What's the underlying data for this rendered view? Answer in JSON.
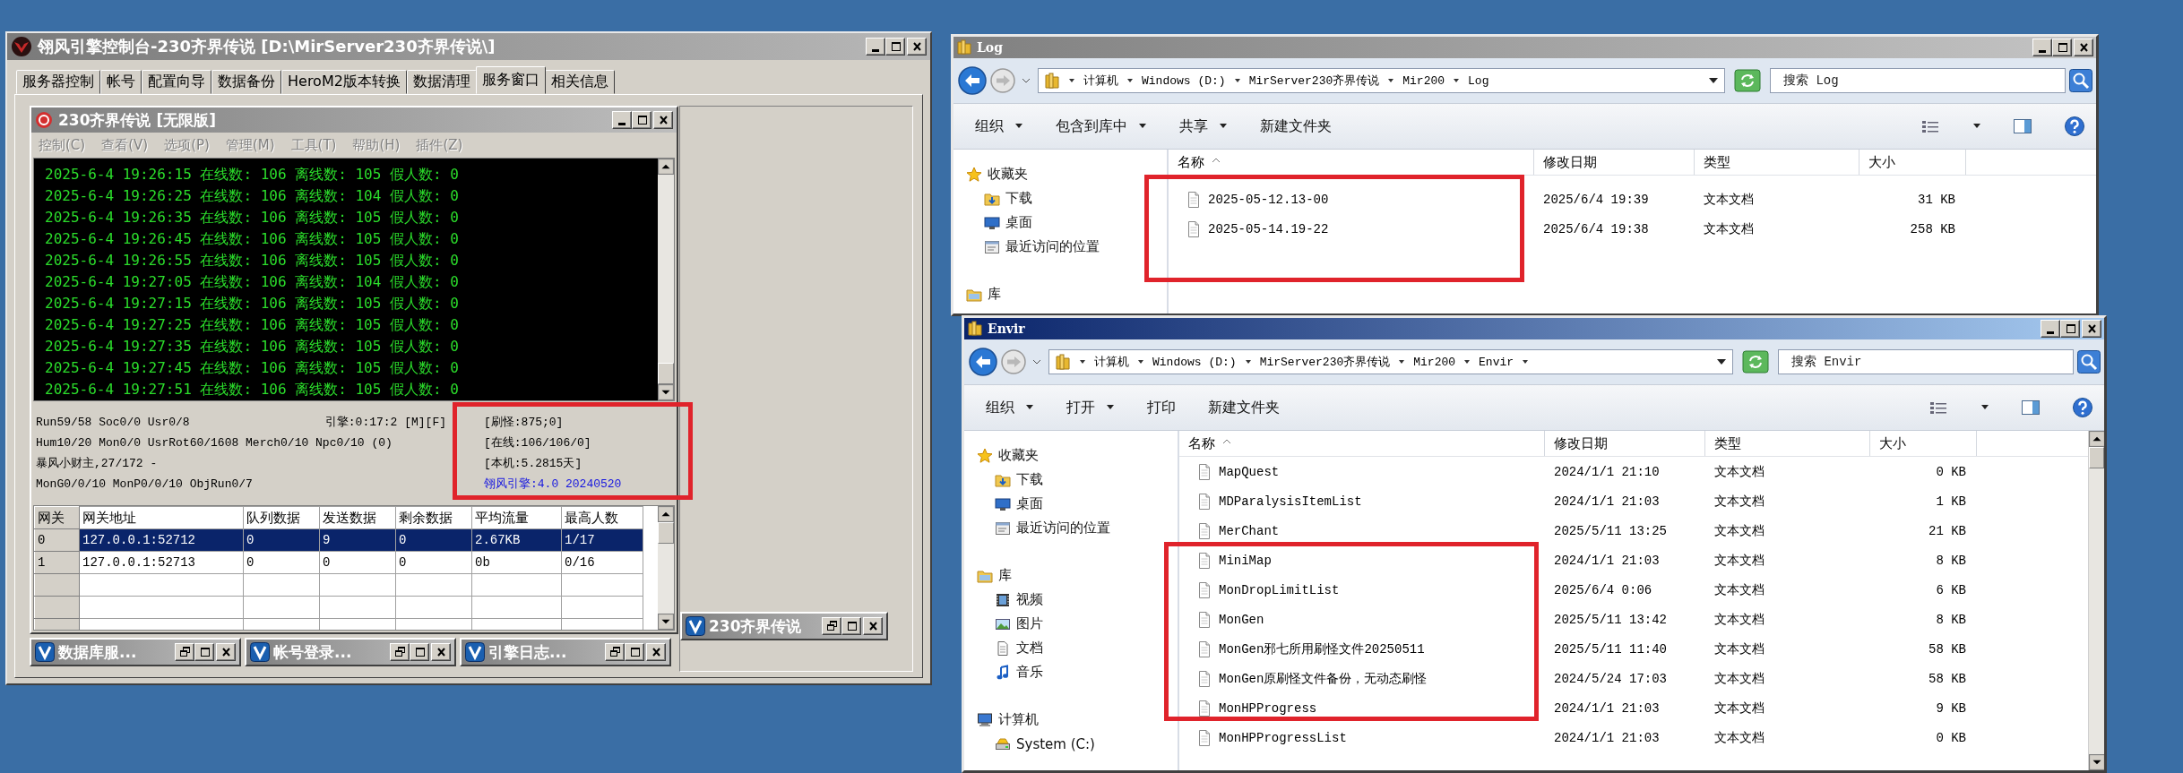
{
  "console_window": {
    "title": "翎风引擎控制台-230齐界传说 [D:\\MirServer230齐界传说\\]",
    "active": false,
    "tabs": [
      {
        "label": "服务器控制",
        "selected": false
      },
      {
        "label": "帐号",
        "selected": false
      },
      {
        "label": "配置向导",
        "selected": false
      },
      {
        "label": "数据备份",
        "selected": false
      },
      {
        "label": "HeroM2版本转换",
        "selected": false
      },
      {
        "label": "数据清理",
        "selected": false
      },
      {
        "label": "服务窗口",
        "selected": true
      },
      {
        "label": "相关信息",
        "selected": false
      }
    ],
    "server_window": {
      "title": "230齐界传说 [无限版]",
      "active": false,
      "menu": [
        {
          "label": "控制(C)",
          "disabled": true
        },
        {
          "label": "查看(V)",
          "disabled": true
        },
        {
          "label": "选项(P)",
          "disabled": true
        },
        {
          "label": "管理(M)",
          "disabled": true
        },
        {
          "label": "工具(T)",
          "disabled": true
        },
        {
          "label": "帮助(H)",
          "disabled": true
        },
        {
          "label": "插件(Z)",
          "disabled": true
        }
      ],
      "log_lines": [
        "2025-6-4 19:26:15 在线数: 106 离线数: 105 假人数: 0",
        "2025-6-4 19:26:25 在线数: 106 离线数: 104 假人数: 0",
        "2025-6-4 19:26:35 在线数: 106 离线数: 105 假人数: 0",
        "2025-6-4 19:26:45 在线数: 106 离线数: 105 假人数: 0",
        "2025-6-4 19:26:55 在线数: 106 离线数: 105 假人数: 0",
        "2025-6-4 19:27:05 在线数: 106 离线数: 104 假人数: 0",
        "2025-6-4 19:27:15 在线数: 106 离线数: 105 假人数: 0",
        "2025-6-4 19:27:25 在线数: 106 离线数: 105 假人数: 0",
        "2025-6-4 19:27:35 在线数: 106 离线数: 105 假人数: 0",
        "2025-6-4 19:27:45 在线数: 106 离线数: 105 假人数: 0",
        "2025-6-4 19:27:51 在线数: 106 离线数: 105 假人数: 0"
      ],
      "stats_left": [
        "Run59/58 Soc0/0 Usr0/8",
        "Hum10/20 Mon0/0 UsrRot60/1608 Merch0/10 Npc0/10 (0)",
        "暴风小财主,27/172 -",
        "MonG0/0/10 MonP0/0/10 ObjRun0/7"
      ],
      "engine_time": "引擎:0:17:2 [M][F]",
      "stats_right": [
        {
          "text": "[刷怪:875;0]",
          "kind": "stat"
        },
        {
          "text": "[在线:106/106/0]",
          "kind": "stat"
        },
        {
          "text": "[本机:5.2815天]",
          "kind": "stat"
        },
        {
          "text": "翎风引擎:4.0 20240520",
          "kind": "version"
        }
      ],
      "gateway_table": {
        "columns": [
          "网关",
          "网关地址",
          "队列数据",
          "发送数据",
          "剩余数据",
          "平均流量",
          "最高人数"
        ],
        "rows": [
          {
            "cells": [
              "0",
              "127.0.0.1:52712",
              "0",
              "9",
              "0",
              "2.67KB",
              "1/17"
            ],
            "selected": true
          },
          {
            "cells": [
              "1",
              "127.0.0.1:52713",
              "0",
              "0",
              "0",
              "0b",
              "0/16"
            ],
            "selected": false
          }
        ]
      }
    },
    "minimized_windows": [
      {
        "title": "230齐界传说"
      }
    ],
    "docked_windows": [
      {
        "title": "数据库服..."
      },
      {
        "title": "帐号登录..."
      },
      {
        "title": "引擎日志..."
      }
    ]
  },
  "log_explorer": {
    "title": "Log",
    "active": false,
    "path": [
      "计算机",
      "Windows (D:)",
      "MirServer230齐界传说",
      "Mir200",
      "Log"
    ],
    "search_placeholder": "搜索 Log",
    "toolbar": [
      {
        "label": "组织",
        "dropdown": true
      },
      {
        "label": "包含到库中",
        "dropdown": true
      },
      {
        "label": "共享",
        "dropdown": true
      },
      {
        "label": "新建文件夹",
        "dropdown": false
      }
    ],
    "nav": [
      {
        "label": "收藏夹",
        "kind": "favorites",
        "children": [
          {
            "label": "下载",
            "kind": "downloads"
          },
          {
            "label": "桌面",
            "kind": "desktop"
          },
          {
            "label": "最近访问的位置",
            "kind": "recent"
          }
        ]
      },
      {
        "label": "库",
        "kind": "libraries"
      }
    ],
    "columns": [
      {
        "label": "名称",
        "sorted": true
      },
      {
        "label": "修改日期",
        "sorted": false
      },
      {
        "label": "类型",
        "sorted": false
      },
      {
        "label": "大小",
        "sorted": false
      }
    ],
    "files": [
      {
        "name": "2025-05-12.13-00",
        "modified": "2025/6/4 19:39",
        "type": "文本文档",
        "size": "31 KB"
      },
      {
        "name": "2025-05-14.19-22",
        "modified": "2025/6/4 19:38",
        "type": "文本文档",
        "size": "258 KB"
      }
    ]
  },
  "envir_explorer": {
    "title": "Envir",
    "active": true,
    "path": [
      "计算机",
      "Windows (D:)",
      "MirServer230齐界传说",
      "Mir200",
      "Envir"
    ],
    "path_dropdown": true,
    "search_placeholder": "搜索 Envir",
    "toolbar": [
      {
        "label": "组织",
        "dropdown": true
      },
      {
        "label": "打开",
        "dropdown": true
      },
      {
        "label": "打印",
        "dropdown": false
      },
      {
        "label": "新建文件夹",
        "dropdown": false
      }
    ],
    "nav": [
      {
        "label": "收藏夹",
        "kind": "favorites",
        "children": [
          {
            "label": "下载",
            "kind": "downloads"
          },
          {
            "label": "桌面",
            "kind": "desktop"
          },
          {
            "label": "最近访问的位置",
            "kind": "recent"
          }
        ]
      },
      {
        "label": "库",
        "kind": "libraries",
        "children": [
          {
            "label": "视频",
            "kind": "videos"
          },
          {
            "label": "图片",
            "kind": "pictures"
          },
          {
            "label": "文档",
            "kind": "documents"
          },
          {
            "label": "音乐",
            "kind": "music"
          }
        ]
      },
      {
        "label": "计算机",
        "kind": "computer",
        "children": [
          {
            "label": "System (C:)",
            "kind": "drive"
          }
        ]
      }
    ],
    "columns": [
      {
        "label": "名称",
        "sorted": true
      },
      {
        "label": "修改日期",
        "sorted": false
      },
      {
        "label": "类型",
        "sorted": false
      },
      {
        "label": "大小",
        "sorted": false
      }
    ],
    "scrollbar": true,
    "files": [
      {
        "name": "MapQuest",
        "modified": "2024/1/1 21:10",
        "type": "文本文档",
        "size": "0 KB"
      },
      {
        "name": "MDParalysisItemList",
        "modified": "2024/1/1 21:03",
        "type": "文本文档",
        "size": "1 KB"
      },
      {
        "name": "MerChant",
        "modified": "2025/5/11 13:25",
        "type": "文本文档",
        "size": "21 KB"
      },
      {
        "name": "MiniMap",
        "modified": "2024/1/1 21:03",
        "type": "文本文档",
        "size": "8 KB"
      },
      {
        "name": "MonDropLimitList",
        "modified": "2025/6/4 0:06",
        "type": "文本文档",
        "size": "6 KB"
      },
      {
        "name": "MonGen",
        "modified": "2025/5/11 13:42",
        "type": "文本文档",
        "size": "8 KB"
      },
      {
        "name": "MonGen邪七所用刷怪文件20250511",
        "modified": "2025/5/11 11:40",
        "type": "文本文档",
        "size": "58 KB"
      },
      {
        "name": "MonGen原刷怪文件备份，无动态刷怪",
        "modified": "2024/5/24 17:03",
        "type": "文本文档",
        "size": "58 KB"
      },
      {
        "name": "MonHPProgress",
        "modified": "2024/1/1 21:03",
        "type": "文本文档",
        "size": "9 KB"
      },
      {
        "name": "MonHPProgressList",
        "modified": "2024/1/1 21:03",
        "type": "文本文档",
        "size": "0 KB"
      }
    ]
  }
}
